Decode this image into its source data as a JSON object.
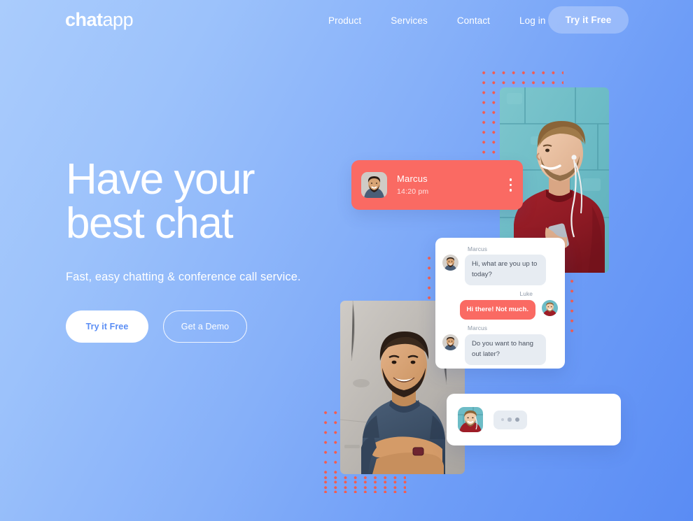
{
  "brand": {
    "logo_bold": "chat",
    "logo_light": "app"
  },
  "nav": {
    "links": [
      {
        "label": "Product"
      },
      {
        "label": "Services"
      },
      {
        "label": "Contact"
      },
      {
        "label": "Log in"
      }
    ],
    "cta_label": "Try it Free"
  },
  "hero": {
    "headline": "Have your\nbest chat",
    "subheadline": "Fast, easy chatting & conference call service.",
    "primary_button": "Try it Free",
    "secondary_button": "Get a Demo"
  },
  "contact_card": {
    "name": "Marcus",
    "time": "14:20 pm",
    "menu_icon": "kebab-menu-icon",
    "background_color": "#fa6a63"
  },
  "chat_window": {
    "messages": [
      {
        "sender": "Marcus",
        "text": "Hi, what are you up to today?",
        "side": "left",
        "style": "grey"
      },
      {
        "sender": "Luke",
        "text": "Hi there! Not much.",
        "side": "right",
        "style": "coral"
      },
      {
        "sender": "Marcus",
        "text": "Do you want to hang out later?",
        "side": "left",
        "style": "grey"
      }
    ]
  },
  "typing_card": {
    "indicator": "typing-dots"
  },
  "decor": {
    "dot_color": "#f45b4e",
    "photo_red_alt": "smiling-man-red-sweater-earphones",
    "photo_blue_alt": "smiling-man-navy-tshirt-arms-crossed"
  },
  "theme": {
    "gradient_from": "#aaccfc",
    "gradient_to": "#5a8cf4",
    "accent": "#fa6a63",
    "text_on_blue": "#ffffff",
    "button_text_blue": "#5b8ef5"
  }
}
